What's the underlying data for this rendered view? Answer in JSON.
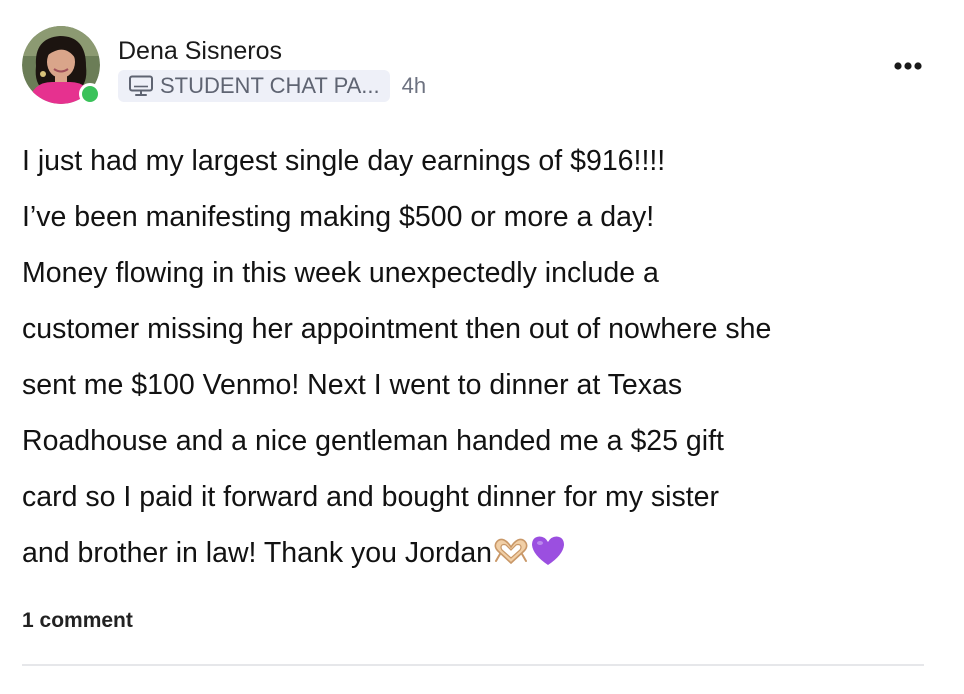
{
  "post": {
    "author_name": "Dena Sisneros",
    "online": true,
    "group_label": "STUDENT CHAT PA...",
    "time_ago": "4h",
    "body_lines": [
      "I just had my largest single day earnings of $916!!!!",
      "I’ve been manifesting making $500 or more a day!",
      "Money flowing in this week unexpectedly include a",
      "customer missing her appointment then out of nowhere she",
      "sent me $100 Venmo! Next I went to dinner at Texas",
      "Roadhouse and a nice gentleman handed me a $25 gift",
      "card so I paid it forward and bought dinner for my sister",
      "and brother in law! Thank you Jordan"
    ],
    "comment_count_label": "1 comment"
  },
  "icons": {
    "group_icon": "computer-monitor-icon",
    "more_icon": "more-options-icon",
    "emoji_1": "heart-hands-emoji",
    "emoji_2": "purple-heart-emoji"
  },
  "colors": {
    "online_dot": "#3ac25a",
    "chip_background": "#eef0f8",
    "avatar_shirt": "#e6318f",
    "purple_heart": "#9b4fe0"
  }
}
